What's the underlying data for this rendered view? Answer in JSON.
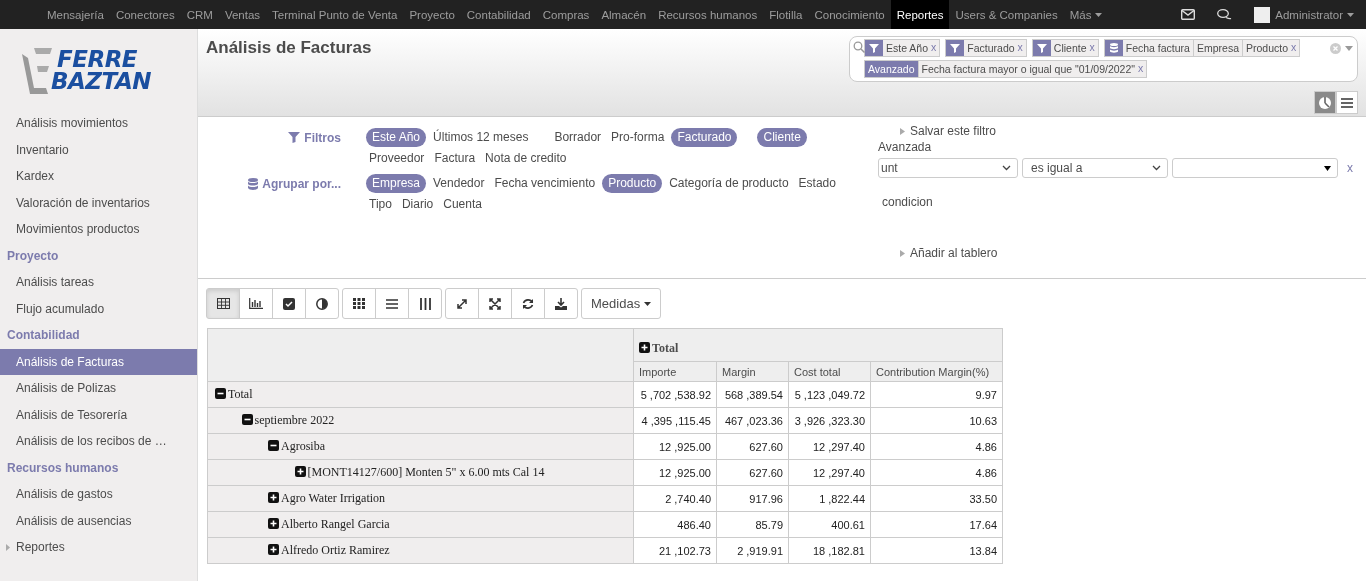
{
  "top_nav": {
    "items": [
      {
        "label": "Mensajería",
        "selected": false
      },
      {
        "label": "Conectores",
        "selected": false
      },
      {
        "label": "CRM",
        "selected": false
      },
      {
        "label": "Ventas",
        "selected": false
      },
      {
        "label": "Terminal Punto de Venta",
        "selected": false
      },
      {
        "label": "Proyecto",
        "selected": false
      },
      {
        "label": "Contabilidad",
        "selected": false
      },
      {
        "label": "Compras",
        "selected": false
      },
      {
        "label": "Almacén",
        "selected": false
      },
      {
        "label": "Recursos humanos",
        "selected": false
      },
      {
        "label": "Flotilla",
        "selected": false
      },
      {
        "label": "Conocimiento",
        "selected": false
      },
      {
        "label": "Reportes",
        "selected": true
      },
      {
        "label": "Users & Companies",
        "selected": false
      }
    ],
    "more": "Más",
    "user": "Administrator"
  },
  "logo": {
    "lines": [
      "FERRE",
      "BAZTAN"
    ]
  },
  "sidebar": {
    "sections": [
      {
        "items": [
          {
            "label": "Análisis movimientos",
            "selected": false,
            "kind": "link"
          },
          {
            "label": "Inventario",
            "selected": false,
            "kind": "link"
          },
          {
            "label": "Kardex",
            "selected": false,
            "kind": "link"
          },
          {
            "label": "Valoración de inventarios",
            "selected": false,
            "kind": "link"
          },
          {
            "label": "Movimientos productos",
            "selected": false,
            "kind": "link"
          }
        ]
      },
      {
        "heading": "Proyecto",
        "items": [
          {
            "label": "Análisis tareas",
            "selected": false,
            "kind": "link"
          },
          {
            "label": "Flujo acumulado",
            "selected": false,
            "kind": "link"
          }
        ]
      },
      {
        "heading": "Contabilidad",
        "items": [
          {
            "label": "Análisis de Facturas",
            "selected": true,
            "kind": "link"
          },
          {
            "label": "Análisis de Polizas",
            "selected": false,
            "kind": "link"
          },
          {
            "label": "Análisis de Tesorería",
            "selected": false,
            "kind": "link"
          },
          {
            "label": "Análisis de los recibos de …",
            "selected": false,
            "kind": "link"
          }
        ]
      },
      {
        "heading": "Recursos humanos",
        "items": [
          {
            "label": "Análisis de gastos",
            "selected": false,
            "kind": "link"
          },
          {
            "label": "Análisis de ausencias",
            "selected": false,
            "kind": "link"
          },
          {
            "label": "Reportes",
            "selected": false,
            "kind": "folder"
          }
        ]
      }
    ]
  },
  "page": {
    "title": "Análisis de Facturas"
  },
  "search": {
    "facets": [
      {
        "kind": "filter",
        "values": [
          "Este Año"
        ],
        "remove": "x"
      },
      {
        "kind": "filter",
        "values": [
          "Facturado"
        ],
        "remove": "x"
      },
      {
        "kind": "filter",
        "values": [
          "Cliente"
        ],
        "remove": "x"
      },
      {
        "kind": "groupby",
        "values": [
          "Fecha factura",
          "Empresa",
          "Producto"
        ],
        "remove": "x"
      },
      {
        "kind": "advanced",
        "label": "Avanzado",
        "values": [
          "Fecha factura mayor o igual que \"01/09/2022\""
        ],
        "remove": "x"
      }
    ]
  },
  "filters": {
    "label": "Filtros",
    "groups": [
      [
        {
          "label": "Este Año",
          "selected": true
        },
        {
          "label": "Últimos 12 meses",
          "selected": false
        }
      ],
      [
        {
          "label": "Borrador",
          "selected": false
        },
        {
          "label": "Pro-forma",
          "selected": false
        },
        {
          "label": "Facturado",
          "selected": true
        }
      ],
      [
        {
          "label": "Cliente",
          "selected": true
        },
        {
          "label": "Proveedor",
          "selected": false
        },
        {
          "label": "Factura",
          "selected": false
        },
        {
          "label": "Nota de credito",
          "selected": false
        }
      ]
    ]
  },
  "group_by": {
    "label": "Agrupar por...",
    "items": [
      {
        "label": "Empresa",
        "selected": true
      },
      {
        "label": "Vendedor",
        "selected": false
      },
      {
        "label": "Fecha vencimiento",
        "selected": false
      },
      {
        "label": "Producto",
        "selected": true
      },
      {
        "label": "Categoría de producto",
        "selected": false
      },
      {
        "label": "Estado",
        "selected": false
      },
      {
        "label": "Tipo",
        "selected": false
      },
      {
        "label": "Diario",
        "selected": false
      },
      {
        "label": "Cuenta",
        "selected": false
      }
    ]
  },
  "favorites": {
    "save": "Salvar este filtro",
    "add_dashboard": "Añadir al tablero"
  },
  "advanced": {
    "title": "Avanzada",
    "field": "unt",
    "operator": "es igual a",
    "remove": "x",
    "add_condition": "condicion"
  },
  "toolbar": {
    "views": [
      {
        "kind": "table",
        "selected": true
      },
      {
        "kind": "bars",
        "selected": false
      },
      {
        "kind": "tasks",
        "selected": false
      },
      {
        "kind": "contrast",
        "selected": false
      }
    ],
    "measures": "Medidas"
  },
  "table": {
    "column_group": "Total",
    "columns": [
      "Importe",
      "Margin",
      "Cost total",
      "Contribution Margin(%)"
    ],
    "rows": [
      {
        "label": "Total",
        "expanded": true,
        "values": [
          "5 ,702 ,538.92",
          "568 ,389.54",
          "5 ,123 ,049.72",
          "9.97"
        ],
        "children": [
          {
            "label": "septiembre 2022",
            "expanded": true,
            "values": [
              "4 ,395 ,115.45",
              "467 ,023.36",
              "3 ,926 ,323.30",
              "10.63"
            ],
            "children": [
              {
                "label": "Agrosiba",
                "expanded": true,
                "values": [
                  "12 ,925.00",
                  "627.60",
                  "12 ,297.40",
                  "4.86"
                ],
                "children": [
                  {
                    "label": "[MONT14127/600] Monten 5\" x 6.00 mts Cal 14",
                    "expanded": false,
                    "values": [
                      "12 ,925.00",
                      "627.60",
                      "12 ,297.40",
                      "4.86"
                    ]
                  }
                ]
              },
              {
                "label": "Agro Water Irrigation",
                "expanded": false,
                "values": [
                  "2 ,740.40",
                  "917.96",
                  "1 ,822.44",
                  "33.50"
                ]
              },
              {
                "label": "Alberto Rangel Garcia",
                "expanded": false,
                "values": [
                  "486.40",
                  "85.79",
                  "400.61",
                  "17.64"
                ]
              },
              {
                "label": "Alfredo Ortiz Ramirez",
                "expanded": false,
                "values": [
                  "21 ,102.73",
                  "2 ,919.91",
                  "18 ,182.81",
                  "13.84"
                ]
              }
            ]
          }
        ]
      }
    ]
  }
}
